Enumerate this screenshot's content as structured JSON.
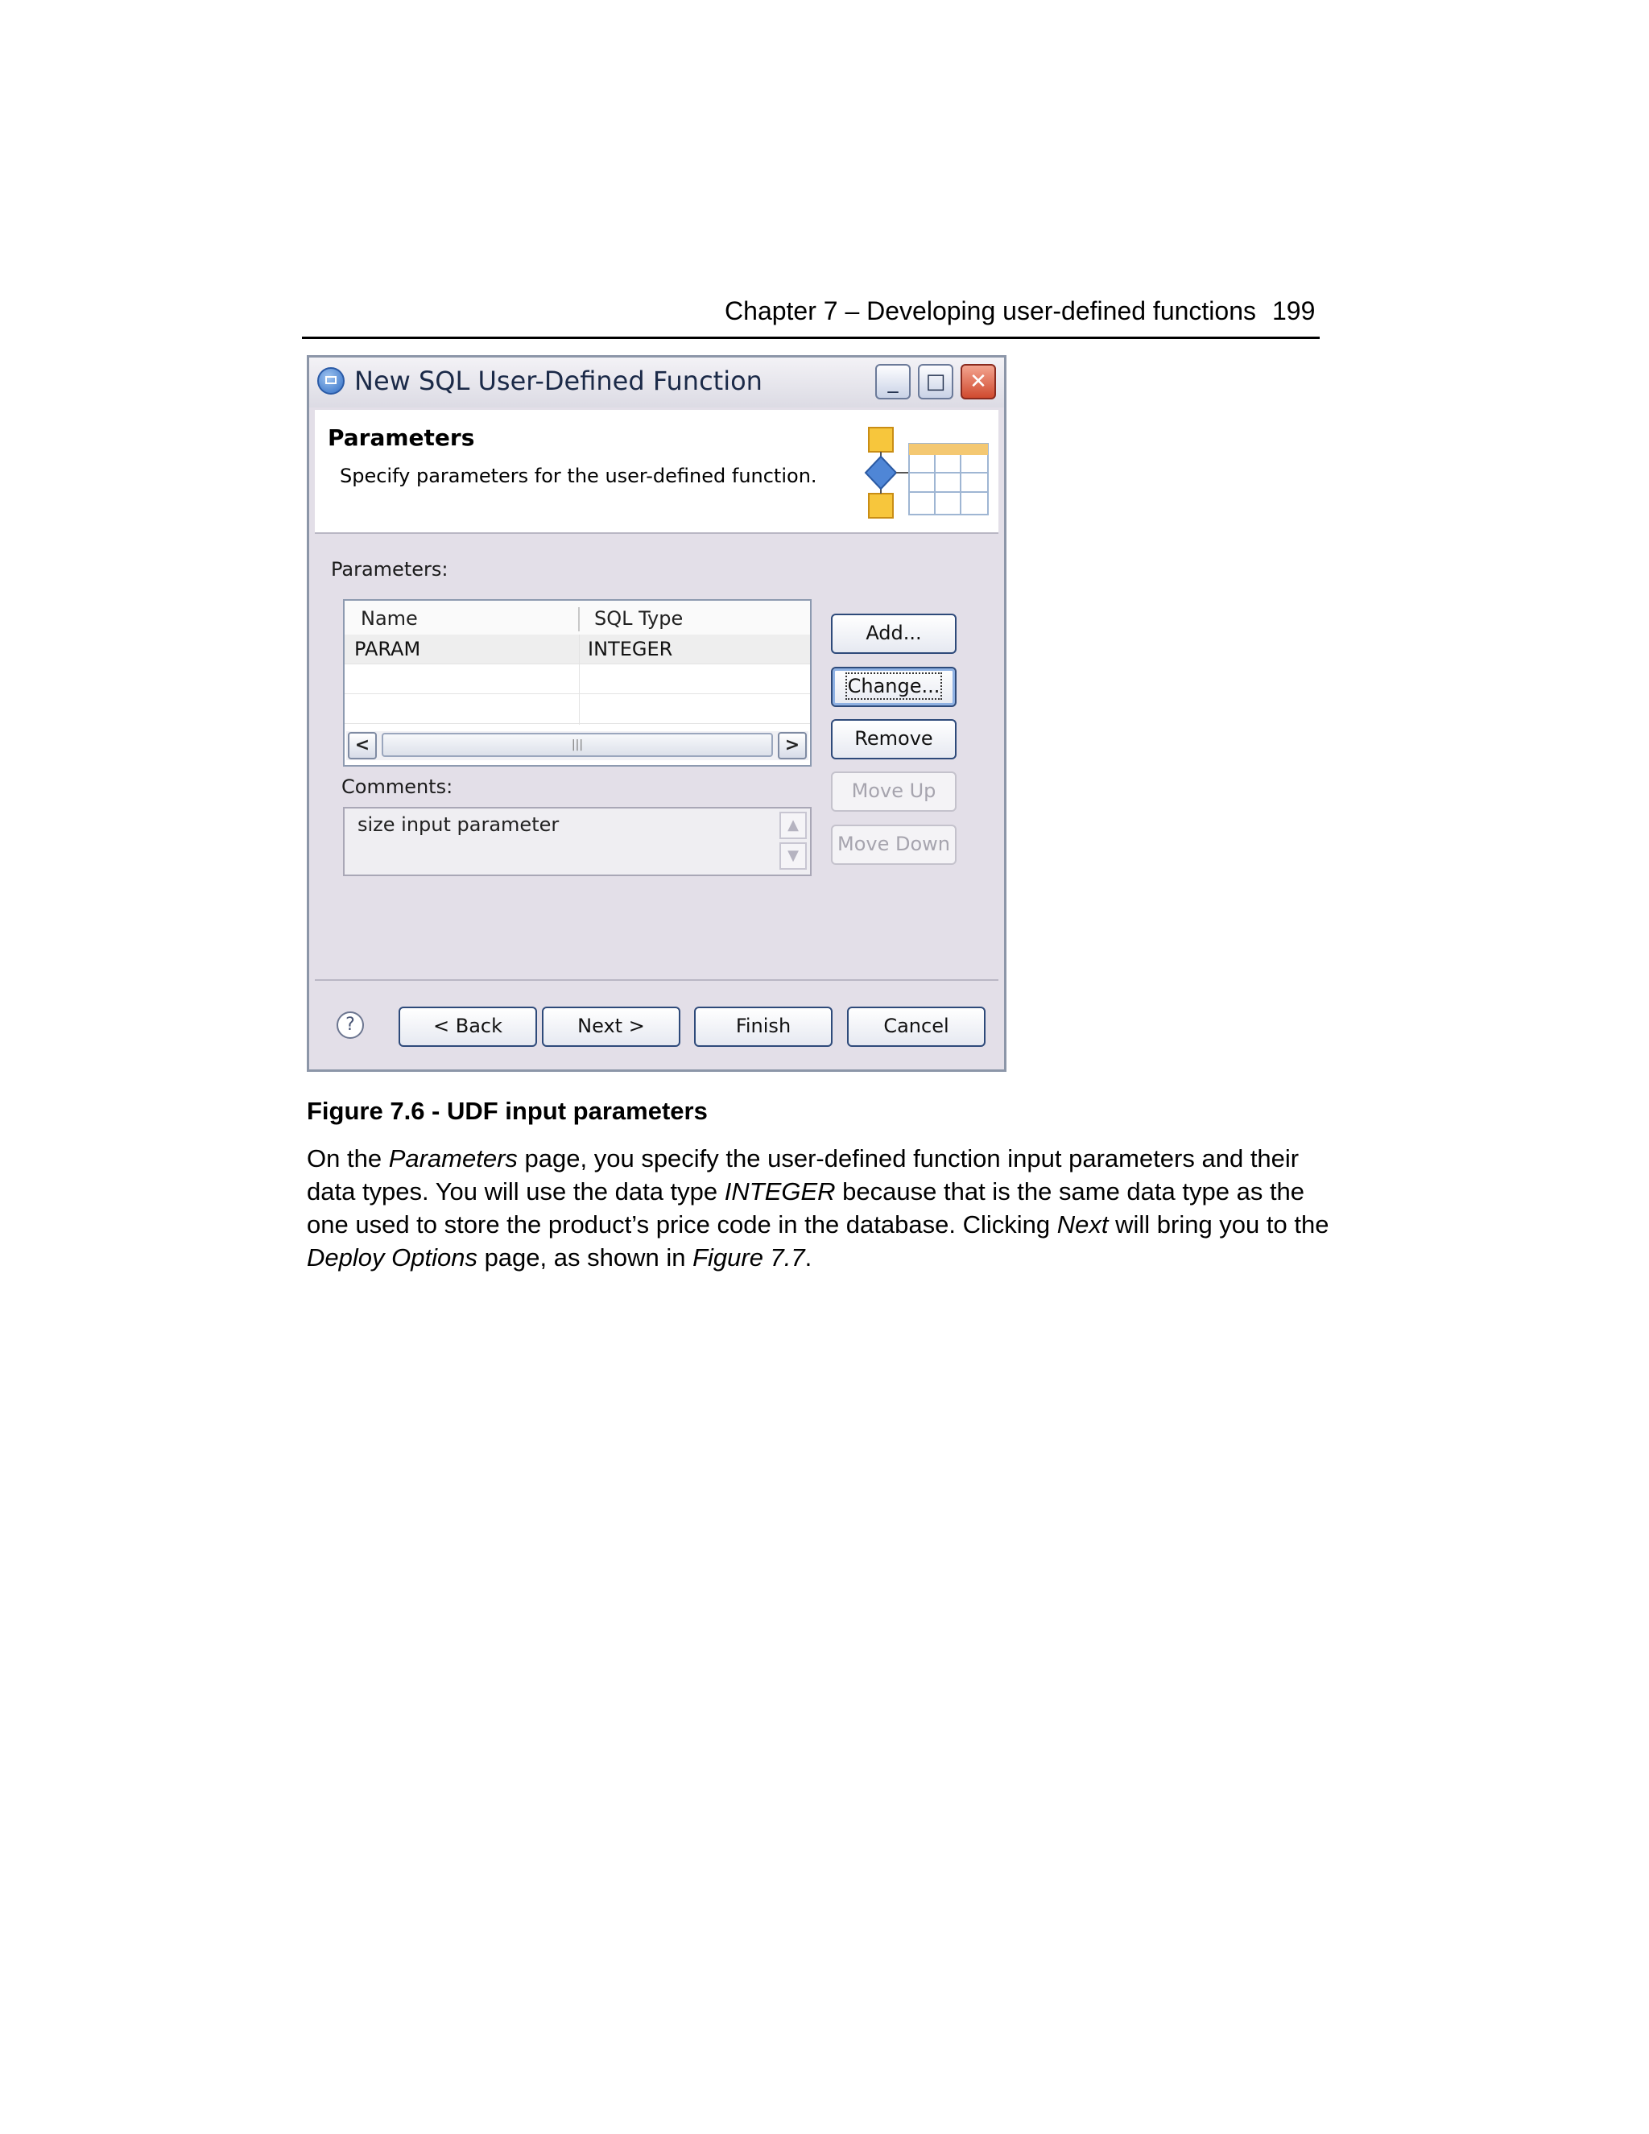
{
  "header": {
    "title": "Chapter 7 – Developing user-defined functions",
    "page_number": "199"
  },
  "dialog": {
    "window_title": "New SQL User-Defined Function",
    "window_buttons": {
      "minimize": "_",
      "maximize": "□",
      "close": "✕"
    },
    "banner": {
      "title": "Parameters",
      "description": "Specify parameters for the user-defined function."
    },
    "parameters_label": "Parameters:",
    "table": {
      "columns": [
        "Name",
        "SQL Type"
      ],
      "rows": [
        {
          "name": "PARAM",
          "sql_type": "INTEGER"
        }
      ],
      "scroll_left": "<",
      "scroll_right": ">",
      "scroll_thumb": "|||"
    },
    "comments_label": "Comments:",
    "comments_value": "size input parameter",
    "side_buttons": {
      "add": "Add...",
      "change": "Change...",
      "remove": "Remove",
      "move_up": "Move Up",
      "move_down": "Move Down"
    },
    "help_glyph": "?",
    "footer_buttons": {
      "back": "< Back",
      "next": "Next >",
      "finish": "Finish",
      "cancel": "Cancel"
    }
  },
  "caption": "Figure 7.6 - UDF input parameters",
  "paragraph": {
    "p1": "On the ",
    "e1": "Parameters",
    "p2": " page, you specify the user-defined function input parameters and their data types. You will use the data type ",
    "e2": "INTEGER",
    "p3": " because that is the same data type as the one used to store the product’s price code in the database. Clicking ",
    "e3": "Next",
    "p4": " will bring you to the ",
    "e4": "Deploy Options",
    "p5": " page, as shown in ",
    "e5": "Figure 7.7",
    "p6": "."
  }
}
